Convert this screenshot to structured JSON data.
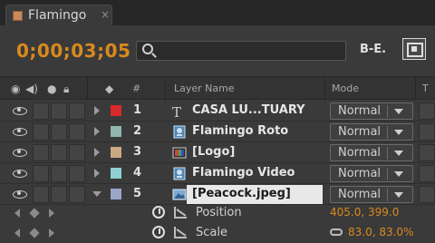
{
  "tab": {
    "title": "Flamingo",
    "close": "×",
    "swatch_color": "#c98a5e"
  },
  "toolbar": {
    "timecode": "0;00;03;05",
    "search_placeholder": "",
    "tool_a_label": "B-E."
  },
  "columns": {
    "layer_name": "Layer Name",
    "mode": "Mode",
    "number": "#",
    "t": "T"
  },
  "layers": [
    {
      "num": "1",
      "name": "CASA LU...TUARY",
      "label_color": "#d62b2b",
      "icon": "text-layer-icon",
      "mode": "Normal"
    },
    {
      "num": "2",
      "name": "Flamingo Roto",
      "label_color": "#8fb7ad",
      "icon": "footage-layer-icon",
      "mode": "Normal"
    },
    {
      "num": "3",
      "name": "[Logo]",
      "label_color": "#c9a882",
      "icon": "composition-layer-icon",
      "mode": "Normal"
    },
    {
      "num": "4",
      "name": "Flamingo Video",
      "label_color": "#8fcfcf",
      "icon": "footage-layer-icon",
      "mode": "Normal"
    },
    {
      "num": "5",
      "name": "[Peacock.jpeg]",
      "label_color": "#9aa6c7",
      "icon": "image-layer-icon",
      "mode": "Normal"
    }
  ],
  "properties": [
    {
      "name": "Position",
      "value": "405.0, 399.0"
    },
    {
      "name": "Scale",
      "value": "83.0, 83.0%"
    }
  ],
  "colors": {
    "accent": "#d88a1e",
    "panel": "#3a3a3a"
  }
}
